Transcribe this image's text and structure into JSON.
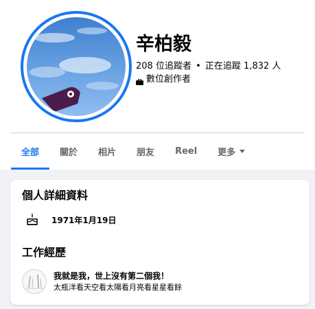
{
  "profile": {
    "name": "辛柏毅",
    "followers": "208 位追蹤者",
    "separator": "•",
    "following": "正在追蹤 1,832 人",
    "category": "數位創作者"
  },
  "tabs": [
    {
      "label": "全部",
      "active": true
    },
    {
      "label": "關於"
    },
    {
      "label": "相片"
    },
    {
      "label": "朋友"
    },
    {
      "label": "Reel"
    },
    {
      "label": "更多"
    }
  ],
  "details": {
    "title": "個人詳細資料",
    "birthday": "1971年1月19日",
    "birthday_icon": "cake-icon"
  },
  "work": {
    "title": "工作經歷",
    "item_title": "我就是我，世上沒有第二個我！",
    "item_subtitle": "太瓶洋看天空看太陽看月亮看星星看餘"
  },
  "colors": {
    "accent": "#1877f2",
    "background": "#f0f2f5",
    "muted_text": "#65676b"
  }
}
